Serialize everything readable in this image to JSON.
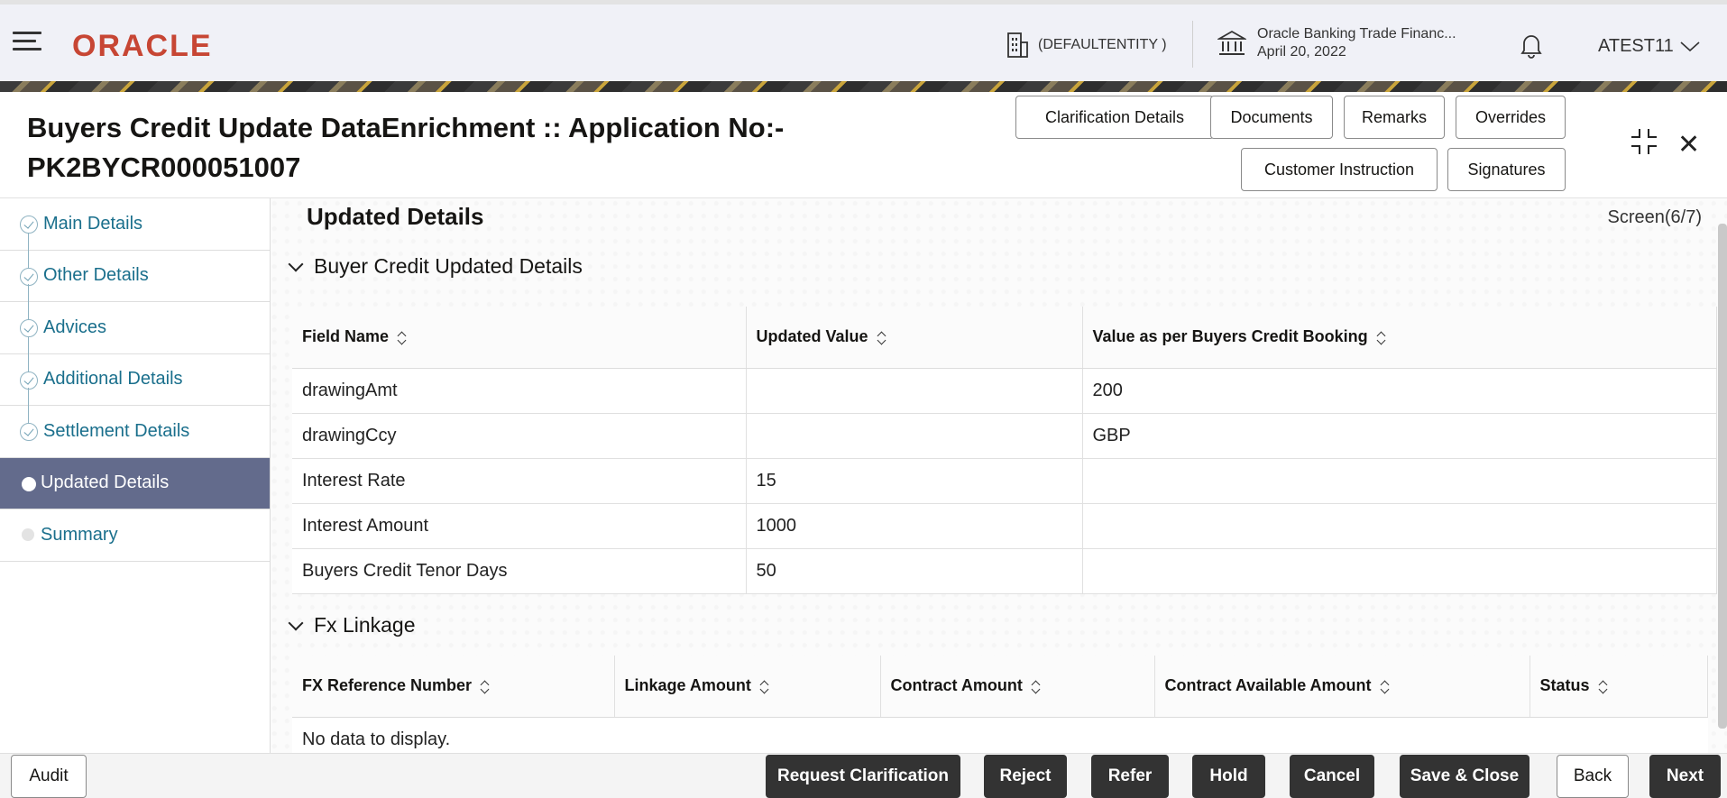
{
  "header": {
    "brand": "ORACLE",
    "entity": "(DEFAULTENTITY )",
    "bank_name": "Oracle Banking Trade Financ...",
    "bank_date": "April 20, 2022",
    "user": "ATEST11"
  },
  "title": {
    "line1": "Buyers Credit Update DataEnrichment :: Application No:-",
    "line2": "PK2BYCR000051007"
  },
  "header_buttons": {
    "clarification": "Clarification Details",
    "documents": "Documents",
    "remarks": "Remarks",
    "overrides": "Overrides",
    "customer_instruction": "Customer Instruction",
    "signatures": "Signatures"
  },
  "nav": {
    "items": [
      {
        "label": "Main Details",
        "state": "done"
      },
      {
        "label": "Other Details",
        "state": "done"
      },
      {
        "label": "Advices",
        "state": "done"
      },
      {
        "label": "Additional Details",
        "state": "done"
      },
      {
        "label": "Settlement Details",
        "state": "done"
      },
      {
        "label": "Updated Details",
        "state": "active"
      },
      {
        "label": "Summary",
        "state": "pending"
      }
    ]
  },
  "content": {
    "section_title": "Updated Details",
    "screen": "Screen(6/7)",
    "buyer_group": "Buyer Credit Updated Details",
    "buyer_table": {
      "headers": [
        "Field Name",
        "Updated Value",
        "Value as per Buyers Credit Booking"
      ],
      "rows": [
        [
          "drawingAmt",
          "",
          "200"
        ],
        [
          "drawingCcy",
          "",
          "GBP"
        ],
        [
          "Interest Rate",
          "15",
          ""
        ],
        [
          "Interest Amount",
          "1000",
          ""
        ],
        [
          "Buyers Credit Tenor Days",
          "50",
          ""
        ]
      ]
    },
    "fx_group": "Fx Linkage",
    "fx_table": {
      "headers": [
        "FX Reference Number",
        "Linkage Amount",
        "Contract Amount",
        "Contract Available Amount",
        "Status"
      ],
      "empty": "No data to display."
    }
  },
  "footer": {
    "audit": "Audit",
    "request_clarification": "Request Clarification",
    "reject": "Reject",
    "refer": "Refer",
    "hold": "Hold",
    "cancel": "Cancel",
    "save_close": "Save & Close",
    "back": "Back",
    "next": "Next"
  }
}
